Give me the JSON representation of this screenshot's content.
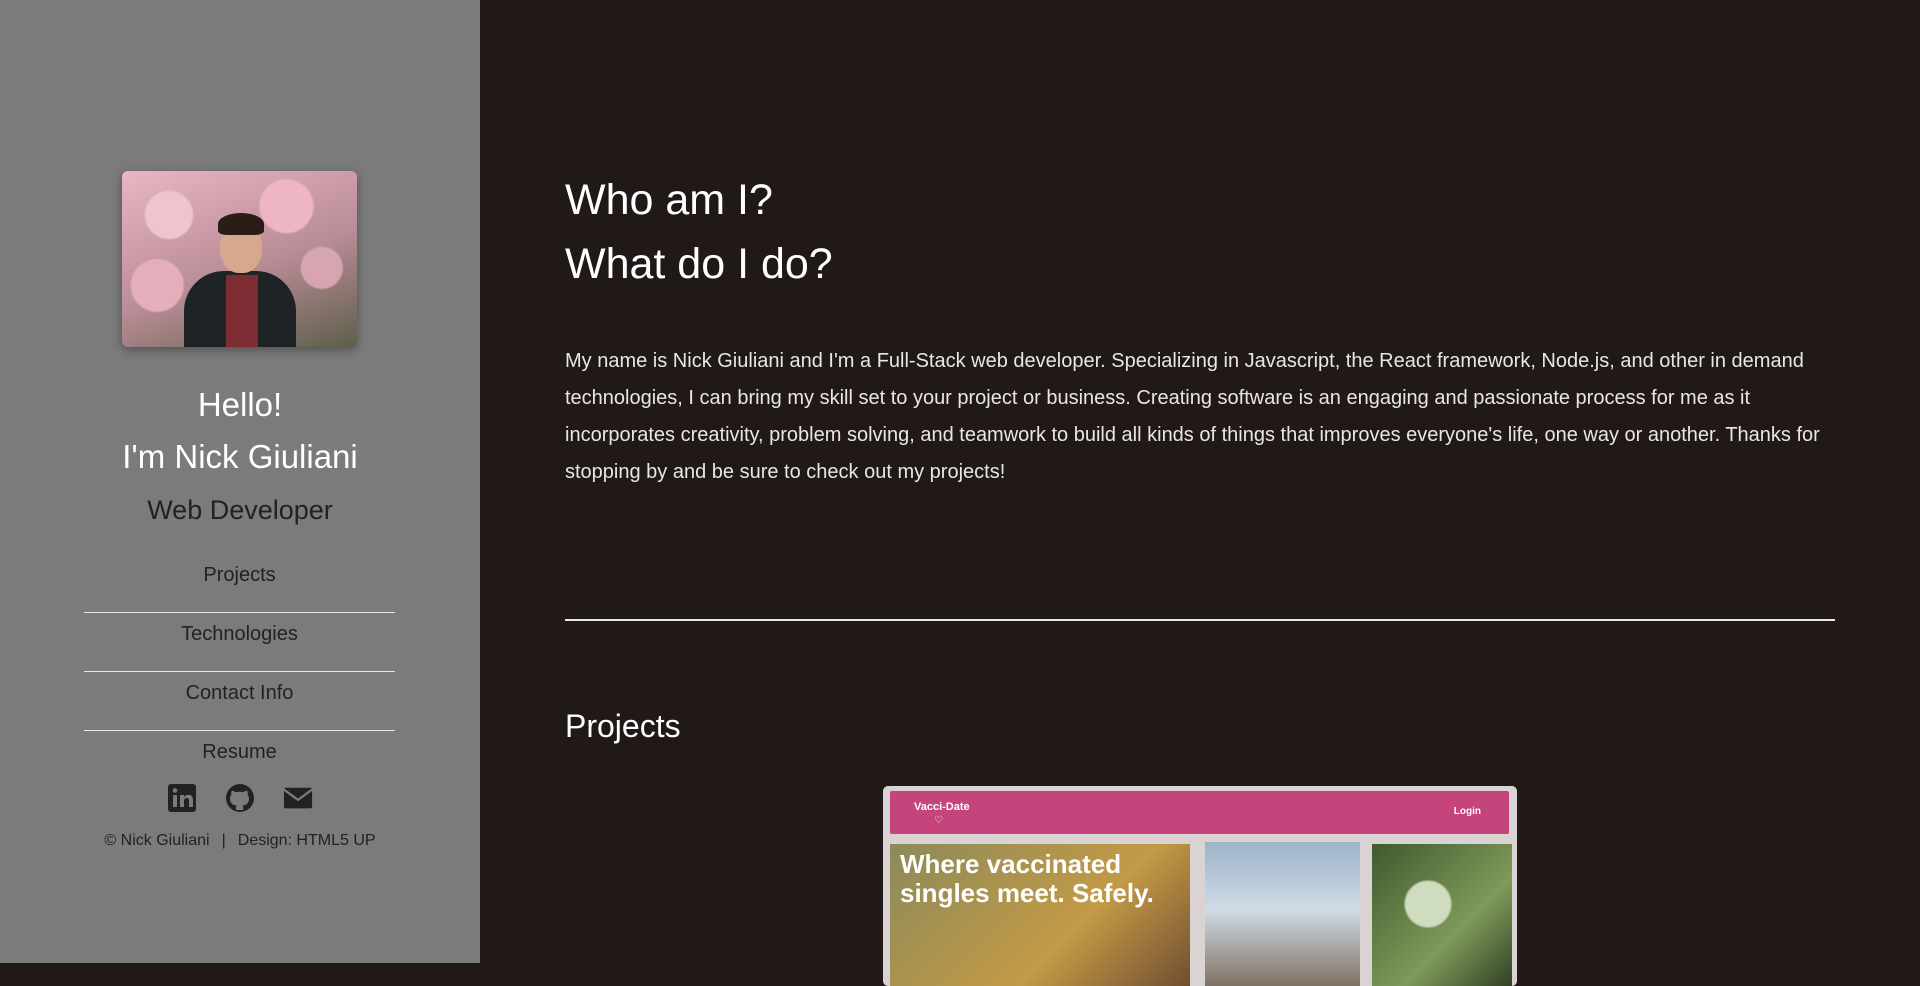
{
  "sidebar": {
    "hello": "Hello!",
    "name": "I'm Nick Giuliani",
    "role": "Web Developer",
    "nav": [
      "Projects",
      "Technologies",
      "Contact Info",
      "Resume"
    ],
    "social_icons": [
      "linkedin-icon",
      "github-icon",
      "envelope-icon"
    ],
    "footer": {
      "copyright": "© Nick Giuliani",
      "separator": "|",
      "design": "Design: HTML5 UP"
    }
  },
  "main": {
    "heading_1": "Who am I?",
    "heading_2": "What do I do?",
    "intro": "My name is Nick Giuliani and I'm a Full-Stack web developer. Specializing in Javascript, the React framework, Node.js, and other in demand technologies, I can bring my skill set to your project or business. Creating software is an engaging and passionate process for me as it incorporates creativity, problem solving, and teamwork to build all kinds of things that improves everyone's life, one way or another. Thanks for stopping by and be sure to check out my projects!",
    "projects_heading": "Projects",
    "project_card": {
      "brand": "Vacci-Date",
      "heart": "♡",
      "login": "Login",
      "tagline": "Where vaccinated singles meet. Safely."
    }
  },
  "colors": {
    "sidebar_bg": "#7b7b7b",
    "main_bg": "#201917",
    "card_accent": "#c4447b"
  }
}
